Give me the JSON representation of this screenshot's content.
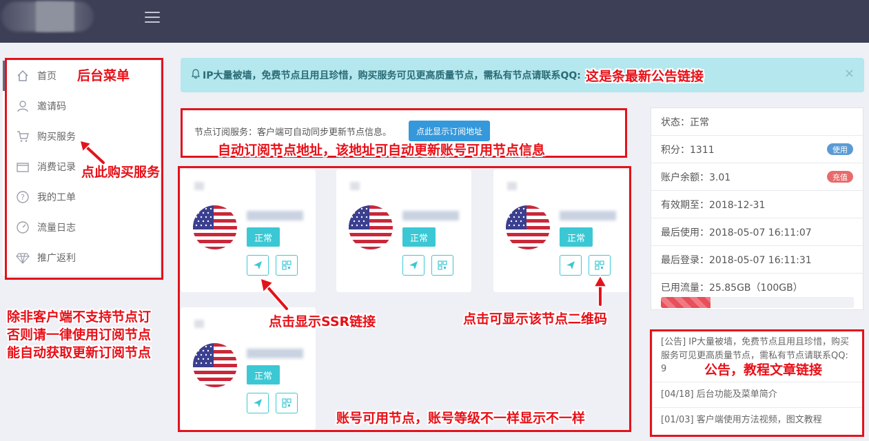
{
  "sidebar": {
    "items": [
      {
        "label": "首页",
        "icon": "home-icon"
      },
      {
        "label": "邀请码",
        "icon": "user-icon"
      },
      {
        "label": "购买服务",
        "icon": "cart-icon"
      },
      {
        "label": "消费记录",
        "icon": "wallet-icon"
      },
      {
        "label": "我的工单",
        "icon": "question-icon"
      },
      {
        "label": "流量日志",
        "icon": "gauge-icon"
      },
      {
        "label": "推广返利",
        "icon": "diamond-icon"
      }
    ]
  },
  "notice": {
    "text": "IP大量被墙，免费节点且用且珍惜，购买服务可见更高质量节点，需私有节点请联系QQ: 9",
    "close": "×"
  },
  "subscription": {
    "text": "节点订阅服务：客户端可自动同步更新节点信息。",
    "button": "点此显示订阅地址"
  },
  "nodes": [
    {
      "status": "正常"
    },
    {
      "status": "正常"
    },
    {
      "status": "正常"
    },
    {
      "status": "正常"
    }
  ],
  "account": {
    "status": "状态：正常",
    "points": "积分：1311",
    "points_badge": "使用",
    "balance": "账户余额：3.01",
    "balance_badge": "充值",
    "expire": "有效期至：2018-12-31",
    "last_use": "最后使用：2018-05-07 16:11:07",
    "last_login": "最后登录：2018-05-07 16:11:31",
    "traffic": "已用流量：25.85GB（100GB）",
    "traffic_fraction": 0.2585
  },
  "news": [
    "[公告] IP大量被墙，免费节点且用且珍惜，购买服务可见更高质量节点，需私有节点请联系QQ: 9",
    "[04/18] 后台功能及菜单简介",
    "[01/03] 客户端使用方法视频，图文教程"
  ],
  "annotations": {
    "menu": "后台菜单",
    "buy": "点此购买服务",
    "latest_notice": "这是条最新公告链接",
    "subscribe": "自动订阅节点地址，该地址可自动更新账号可用节点信息",
    "advice_1": "除非客户端不支持节点订",
    "advice_2": "否则请一律使用订阅节点",
    "advice_3": "能自动获取更新订阅节点",
    "ssr": "点击显示SSR链接",
    "qr": "点击可显示该节点二维码",
    "news": "公告，教程文章链接",
    "nodes": "账号可用节点，账号等级不一样显示不一样"
  },
  "colors": {
    "topbar": "#3c3f55",
    "accent": "#3bc8d4",
    "primary_button": "#3498db",
    "annotation": "#e3121b",
    "badge_use": "#5b9bd5",
    "badge_recharge": "#e86b6b"
  }
}
